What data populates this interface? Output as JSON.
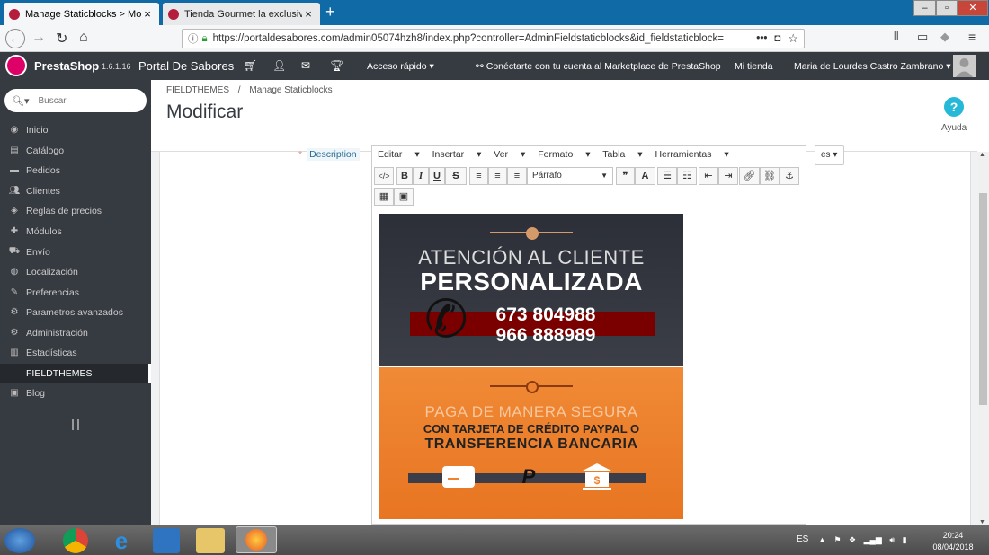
{
  "browser": {
    "tabs": [
      {
        "title": "Manage Staticblocks > Modific",
        "active": true
      },
      {
        "title": "Tienda Gourmet la exclusividad",
        "active": false
      }
    ],
    "url": "https://portaldesabores.com/admin05074hzh8/index.php?controller=AdminFieldstaticblocks&id_fieldstaticblock="
  },
  "header": {
    "brand": "PrestaShop",
    "version": "1.6.1.16",
    "shop_name": "Portal De Sabores",
    "quick_access": "Acceso rápido",
    "marketplace": "Conéctarte con tu cuenta al Marketplace de PrestaShop",
    "my_shop": "Mi tienda",
    "user": "Maria de Lourdes Castro Zambrano"
  },
  "sidebar": {
    "search_placeholder": "Buscar",
    "items": [
      {
        "label": "Inicio",
        "icon": "dashboard-icon"
      },
      {
        "label": "Catálogo",
        "icon": "catalog-icon"
      },
      {
        "label": "Pedidos",
        "icon": "credit-card-icon"
      },
      {
        "label": "Clientes",
        "icon": "users-icon"
      },
      {
        "label": "Reglas de precios",
        "icon": "tag-icon"
      },
      {
        "label": "Módulos",
        "icon": "puzzle-icon"
      },
      {
        "label": "Envío",
        "icon": "truck-icon"
      },
      {
        "label": "Localización",
        "icon": "globe-icon"
      },
      {
        "label": "Preferencias",
        "icon": "wrench-icon"
      },
      {
        "label": "Parametros avanzados",
        "icon": "cogs-icon"
      },
      {
        "label": "Administración",
        "icon": "gear-icon"
      },
      {
        "label": "Estadísticas",
        "icon": "bar-chart-icon"
      },
      {
        "label": "FIELDTHEMES",
        "icon": "none",
        "active": true
      },
      {
        "label": "Blog",
        "icon": "book-icon"
      }
    ]
  },
  "page": {
    "breadcrumb": [
      "FIELDTHEMES",
      "Manage Staticblocks"
    ],
    "title": "Modificar",
    "help_label": "Ayuda"
  },
  "form": {
    "description_label": "Description",
    "language": "es",
    "editor_menu": [
      "Editar",
      "Insertar",
      "Ver",
      "Formato",
      "Tabla",
      "Herramientas"
    ],
    "format_select": "Párrafo"
  },
  "banner1": {
    "line1": "ATENCIÓN AL CLIENTE",
    "line2": "PERSONALIZADA",
    "phone1": "673 804988",
    "phone2": "966 888989"
  },
  "banner2": {
    "line1": "PAGA DE MANERA SEGURA",
    "line2": "CON TARJETA DE CRÉDITO PAYPAL O",
    "line3": "TRANSFERENCIA BANCARIA"
  },
  "taskbar": {
    "language": "ES",
    "time": "20:24",
    "date": "08/04/2018"
  },
  "colors": {
    "sidebar_bg": "#363a41",
    "brand_pink": "#df0067",
    "help_blue": "#25b9d7",
    "banner_orange": "#ef8230",
    "banner_dark": "#2c2f38"
  }
}
